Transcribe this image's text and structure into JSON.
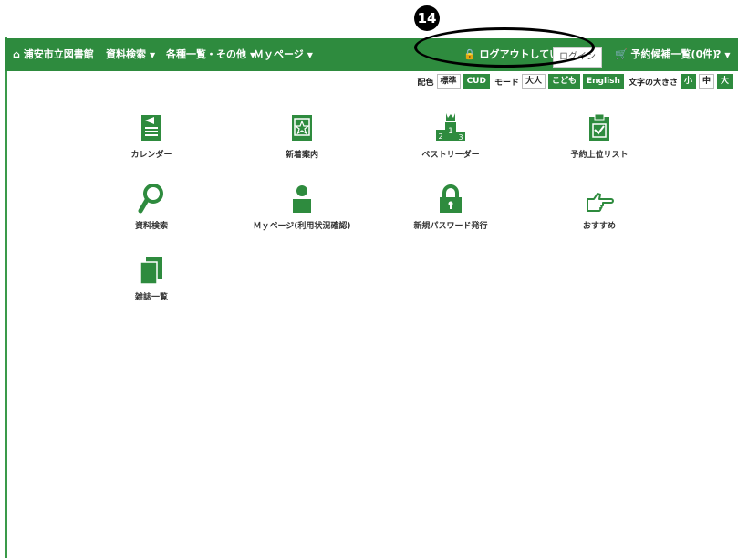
{
  "annotation_number": "14",
  "header": {
    "home": "浦安市立図書館",
    "menus": [
      "資料検索",
      "各種一覧・その他",
      "Ｍｙページ"
    ],
    "status": "ログアウトしています",
    "login_label": "ログイン",
    "reserve_cart": "予約候補一覧(0件)",
    "help": "?"
  },
  "toolbar": {
    "color_label": "配色",
    "color_options": [
      "標準",
      "CUD"
    ],
    "mode_label": "モード",
    "mode_options": [
      "大人",
      "こども",
      "English"
    ],
    "text_size_label": "文字の大きさ",
    "size_options": [
      "小",
      "中",
      "大"
    ]
  },
  "tiles": [
    {
      "label": "カレンダー",
      "icon": "calendar-icon"
    },
    {
      "label": "新着案内",
      "icon": "new-arrivals-icon"
    },
    {
      "label": "ベストリーダー",
      "icon": "podium-icon"
    },
    {
      "label": "予約上位リスト",
      "icon": "clipboard-icon"
    },
    {
      "label": "資料検索",
      "icon": "search-icon"
    },
    {
      "label": "Ｍｙページ(利用状況確認)",
      "icon": "person-icon"
    },
    {
      "label": "新規パスワード発行",
      "icon": "lock-icon"
    },
    {
      "label": "おすすめ",
      "icon": "pointing-hand-icon"
    },
    {
      "label": "雑誌一覧",
      "icon": "magazine-icon"
    }
  ],
  "colors": {
    "brand_green": "#2e8b3e"
  }
}
